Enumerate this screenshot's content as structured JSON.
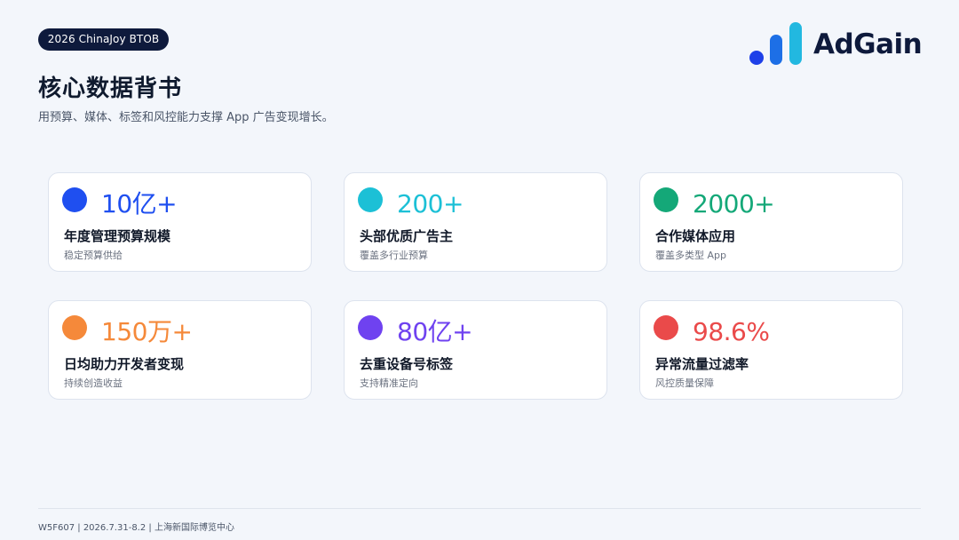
{
  "header": {
    "badge": "2026 ChinaJoy BTOB",
    "title": "核心数据背书",
    "subtitle": "用预算、媒体、标签和风控能力支撑 App 广告变现增长。"
  },
  "logo": {
    "text": "AdGain",
    "icon": "bar-chart-logo-icon",
    "colors": [
      "#1e40e8",
      "#1d7be0",
      "#22b8e0"
    ]
  },
  "stats": [
    {
      "value": "10亿+",
      "label": "年度管理预算规模",
      "note": "稳定预算供给",
      "color": "#1f4ff0"
    },
    {
      "value": "200+",
      "label": "头部优质广告主",
      "note": "覆盖多行业预算",
      "color": "#1cc0d6"
    },
    {
      "value": "2000+",
      "label": "合作媒体应用",
      "note": "覆盖多类型 App",
      "color": "#14a878"
    },
    {
      "value": "150万+",
      "label": "日均助力开发者变现",
      "note": "持续创造收益",
      "color": "#f5893a"
    },
    {
      "value": "80亿+",
      "label": "去重设备号标签",
      "note": "支持精准定向",
      "color": "#6f42f0"
    },
    {
      "value": "98.6%",
      "label": "异常流量过滤率",
      "note": "风控质量保障",
      "color": "#ea4a4a"
    }
  ],
  "footer": {
    "text": "W5F607 | 2026.7.31-8.2 | 上海新国际博览中心"
  }
}
